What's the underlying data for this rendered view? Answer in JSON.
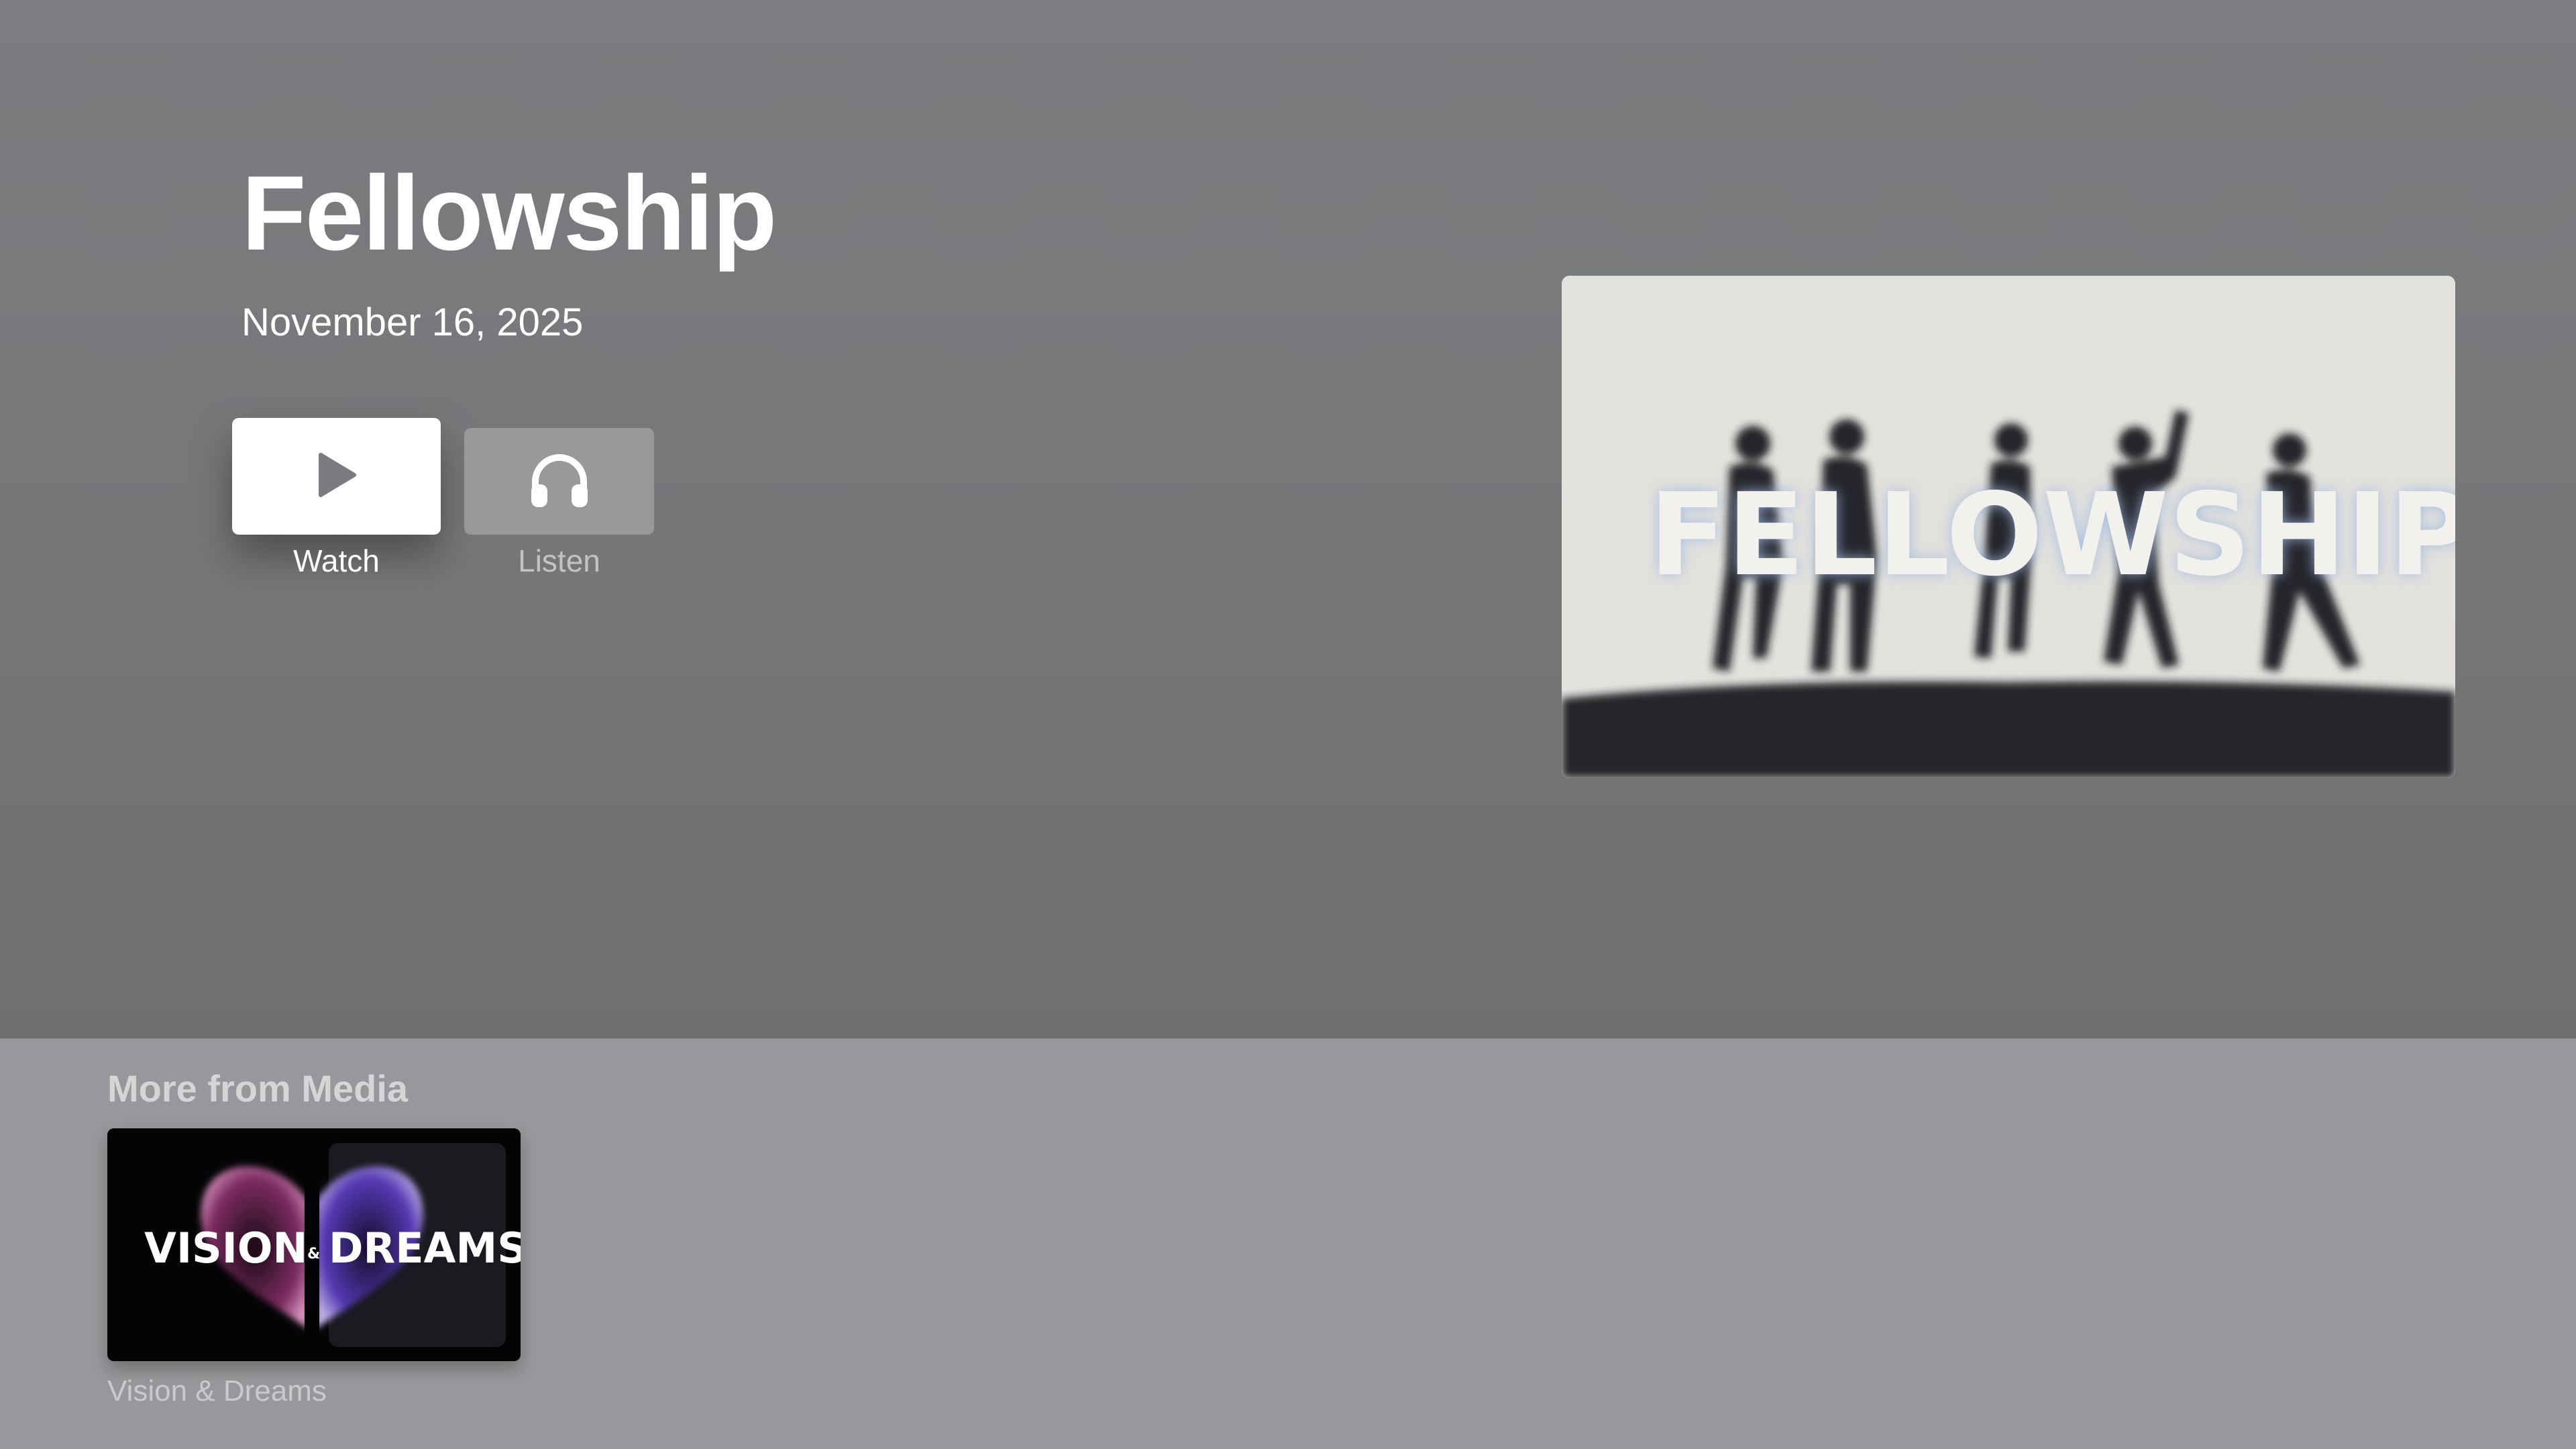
{
  "show": {
    "title": "Fellowship",
    "date": "November 16, 2025",
    "artwork_text": "FELLOWSHIP"
  },
  "actions": {
    "watch_label": "Watch",
    "listen_label": "Listen",
    "watch_icon": "play-icon",
    "listen_icon": "headphones-icon"
  },
  "more": {
    "heading": "More from Media",
    "items": [
      {
        "label": "Vision & Dreams",
        "artwork_word_left": "VISION",
        "artwork_ampersand": "&",
        "artwork_word_right": "DREAMS"
      }
    ]
  },
  "colors": {
    "hero_background": "#76777a",
    "shelf_background": "#97989b",
    "text_primary": "#ffffff",
    "text_secondary": "#c9cacc"
  }
}
